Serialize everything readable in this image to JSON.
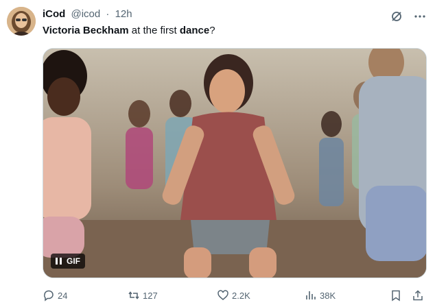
{
  "tweet": {
    "author_name": "iCod",
    "author_handle": "@icod",
    "separator": "·",
    "time": "12h",
    "text_part1": "Victoria Beckham",
    "text_part2": " at the first ",
    "text_part3": "dance",
    "text_part4": "?"
  },
  "media": {
    "badge_label": "GIF"
  },
  "actions": {
    "replies": "24",
    "retweets": "127",
    "likes": "2.2K",
    "views": "38K"
  },
  "icons": {
    "grok": "grok-icon",
    "more": "more-icon",
    "reply": "reply-icon",
    "retweet": "retweet-icon",
    "like": "heart-icon",
    "views": "views-icon",
    "bookmark": "bookmark-icon",
    "share": "share-icon"
  },
  "colors": {
    "text_primary": "#0f1419",
    "text_secondary": "#536471",
    "border": "#cfd9de"
  }
}
